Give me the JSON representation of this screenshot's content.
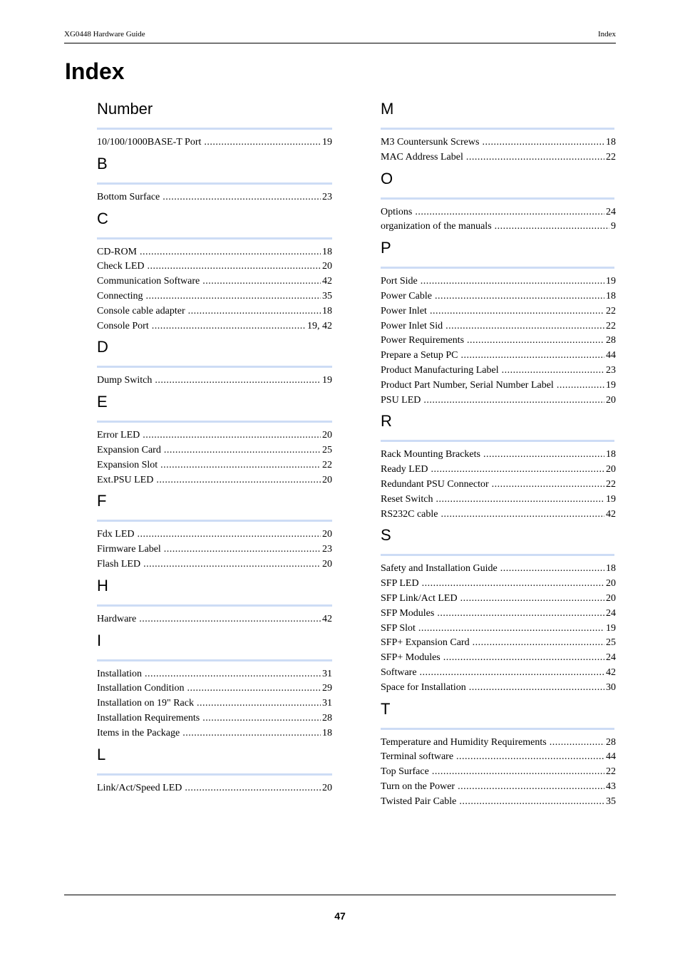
{
  "header": {
    "document_title": "XG0448 Hardware Guide",
    "section_name": "Index"
  },
  "page_title": "Index",
  "left_column": [
    {
      "letter": "Number",
      "entries": [
        {
          "term": "10/100/1000BASE-T Port",
          "page": "19"
        }
      ]
    },
    {
      "letter": "B",
      "entries": [
        {
          "term": "Bottom Surface",
          "page": "23"
        }
      ]
    },
    {
      "letter": "C",
      "entries": [
        {
          "term": "CD-ROM",
          "page": "18"
        },
        {
          "term": "Check LED",
          "page": "20"
        },
        {
          "term": "Communication Software",
          "page": "42"
        },
        {
          "term": "Connecting",
          "page": "35"
        },
        {
          "term": "Console cable adapter",
          "page": "18"
        },
        {
          "term": "Console Port",
          "page": "19, 42"
        }
      ]
    },
    {
      "letter": "D",
      "entries": [
        {
          "term": "Dump Switch",
          "page": "19"
        }
      ]
    },
    {
      "letter": "E",
      "entries": [
        {
          "term": "Error LED",
          "page": "20"
        },
        {
          "term": "Expansion Card",
          "page": "25"
        },
        {
          "term": "Expansion Slot",
          "page": "22"
        },
        {
          "term": "Ext.PSU LED",
          "page": "20"
        }
      ]
    },
    {
      "letter": "F",
      "entries": [
        {
          "term": "Fdx LED",
          "page": "20"
        },
        {
          "term": "Firmware Label",
          "page": "23"
        },
        {
          "term": "Flash LED",
          "page": "20"
        }
      ]
    },
    {
      "letter": "H",
      "entries": [
        {
          "term": "Hardware",
          "page": "42"
        }
      ]
    },
    {
      "letter": "I",
      "entries": [
        {
          "term": "Installation",
          "page": "31"
        },
        {
          "term": "Installation Condition",
          "page": "29"
        },
        {
          "term": "Installation on 19\" Rack",
          "page": "31"
        },
        {
          "term": "Installation Requirements",
          "page": "28"
        },
        {
          "term": "Items in the Package",
          "page": "18"
        }
      ]
    },
    {
      "letter": "L",
      "entries": [
        {
          "term": "Link/Act/Speed LED",
          "page": "20"
        }
      ]
    }
  ],
  "right_column": [
    {
      "letter": "M",
      "entries": [
        {
          "term": "M3 Countersunk Screws",
          "page": "18"
        },
        {
          "term": "MAC Address Label",
          "page": "22"
        }
      ]
    },
    {
      "letter": "O",
      "entries": [
        {
          "term": "Options",
          "page": "24"
        },
        {
          "term": "organization of the manuals",
          "page": "9"
        }
      ]
    },
    {
      "letter": "P",
      "entries": [
        {
          "term": "Port Side",
          "page": "19"
        },
        {
          "term": "Power Cable",
          "page": "18"
        },
        {
          "term": "Power Inlet",
          "page": "22"
        },
        {
          "term": "Power Inlet Sid",
          "page": "22"
        },
        {
          "term": "Power Requirements",
          "page": "28"
        },
        {
          "term": "Prepare a Setup PC",
          "page": "44"
        },
        {
          "term": "Product Manufacturing Label",
          "page": "23"
        },
        {
          "term": "Product Part Number, Serial Number Label",
          "page": "19"
        },
        {
          "term": "PSU LED",
          "page": "20"
        }
      ]
    },
    {
      "letter": "R",
      "entries": [
        {
          "term": "Rack Mounting Brackets",
          "page": "18"
        },
        {
          "term": "Ready LED",
          "page": "20"
        },
        {
          "term": "Redundant PSU Connector",
          "page": "22"
        },
        {
          "term": "Reset Switch",
          "page": "19"
        },
        {
          "term": "RS232C cable",
          "page": "42"
        }
      ]
    },
    {
      "letter": "S",
      "entries": [
        {
          "term": "Safety and Installation Guide",
          "page": "18"
        },
        {
          "term": "SFP LED",
          "page": "20"
        },
        {
          "term": "SFP Link/Act LED",
          "page": "20"
        },
        {
          "term": "SFP Modules",
          "page": "24"
        },
        {
          "term": "SFP Slot",
          "page": "19"
        },
        {
          "term": "SFP+ Expansion Card",
          "page": "25"
        },
        {
          "term": "SFP+ Modules",
          "page": "24"
        },
        {
          "term": "Software",
          "page": "42"
        },
        {
          "term": "Space for Installation",
          "page": "30"
        }
      ]
    },
    {
      "letter": "T",
      "entries": [
        {
          "term": "Temperature and Humidity Requirements",
          "page": "28"
        },
        {
          "term": "Terminal software",
          "page": "44"
        },
        {
          "term": "Top Surface",
          "page": "22"
        },
        {
          "term": "Turn on the Power",
          "page": "43"
        },
        {
          "term": "Twisted Pair Cable",
          "page": "35"
        }
      ]
    }
  ],
  "footer": {
    "page_number": "47"
  },
  "colors": {
    "section_rule": "#cddcf5",
    "text": "#000000"
  }
}
